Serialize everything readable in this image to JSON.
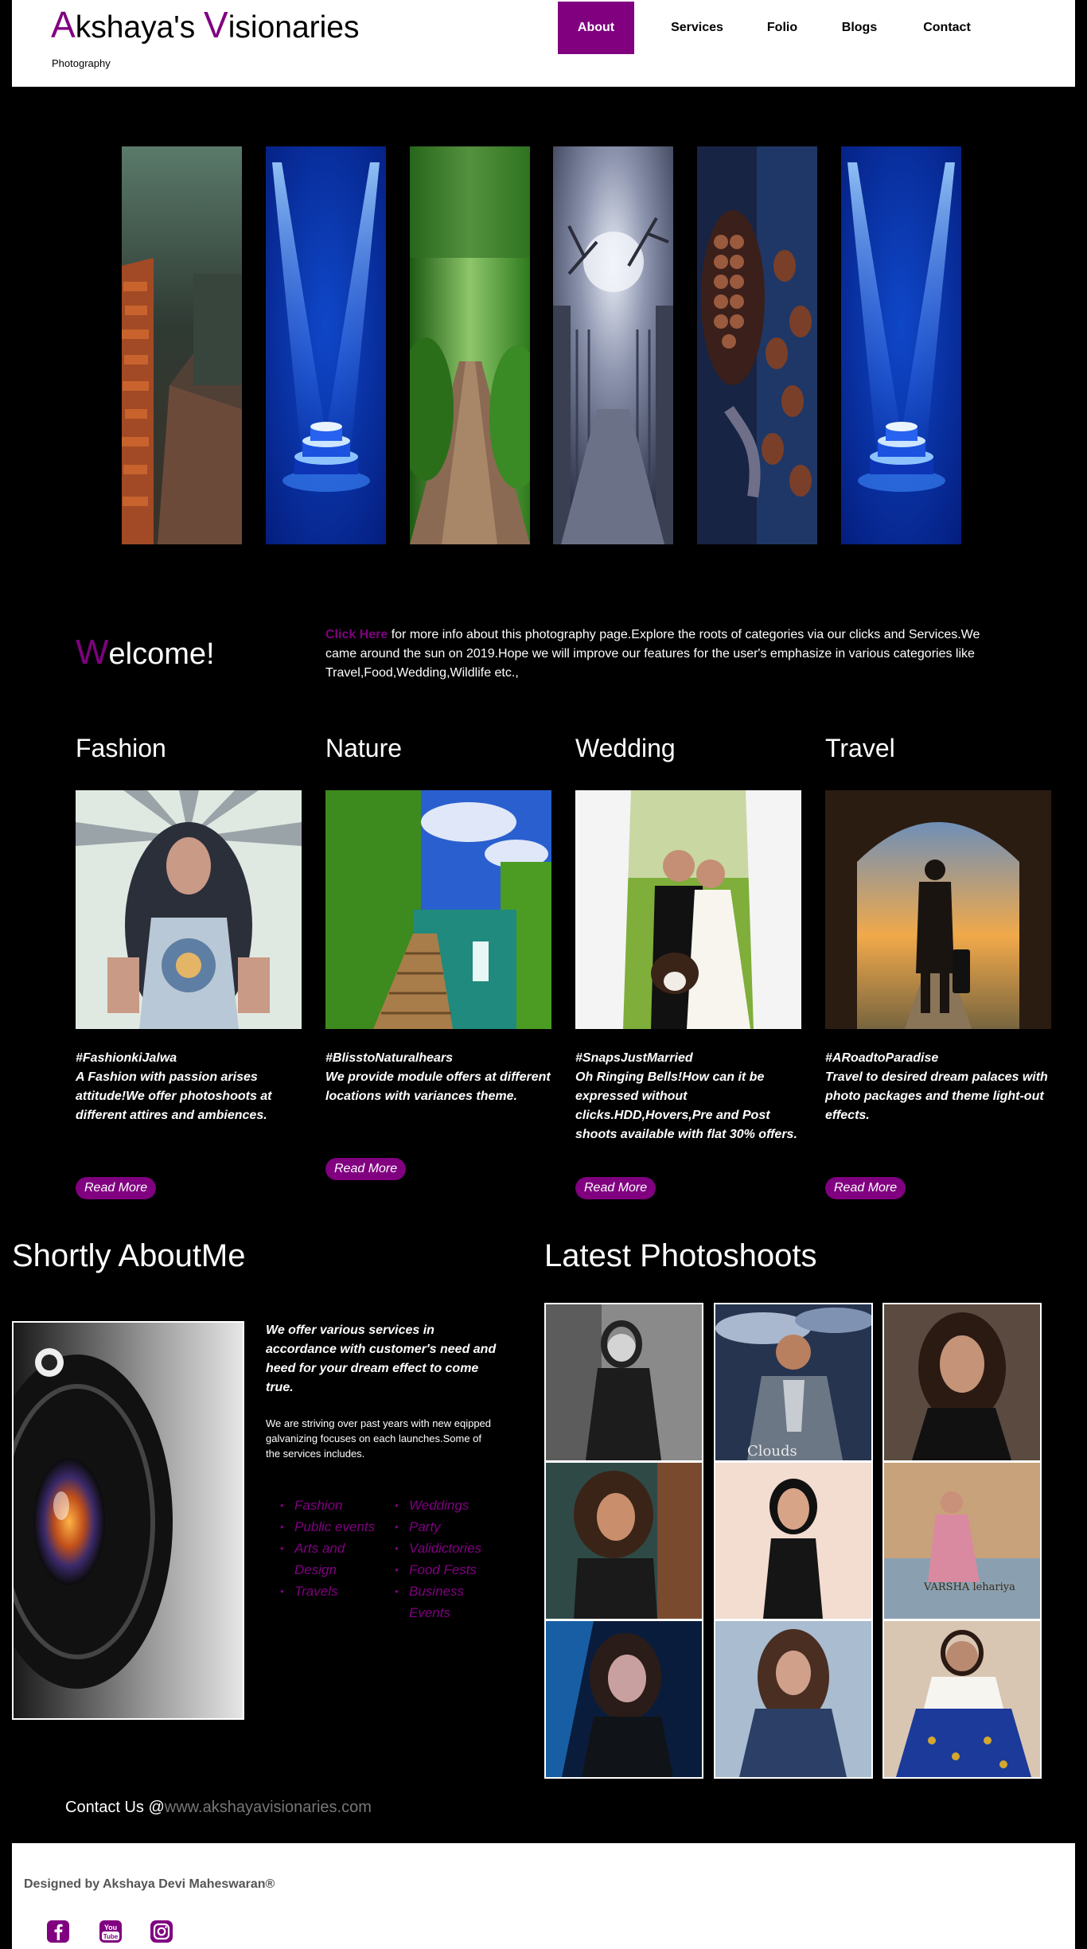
{
  "brand": {
    "first_initial": "A",
    "first_rest": "kshaya's ",
    "second_initial": "V",
    "second_rest": "isionaries",
    "tagline": "Photography",
    "accent_color": "#800080"
  },
  "nav": {
    "items": [
      {
        "label": "About",
        "active": true
      },
      {
        "label": "Services",
        "active": false
      },
      {
        "label": "Folio",
        "active": false
      },
      {
        "label": "Blogs",
        "active": false
      },
      {
        "label": "Contact",
        "active": false
      }
    ]
  },
  "hero": {
    "strips": [
      "brick-wall-path-image",
      "blue-spotlight-stage-image",
      "forest-trail-image",
      "moonlit-gate-image",
      "chocolate-truffles-image",
      "blue-spotlight-stage-image"
    ]
  },
  "welcome": {
    "initial": "W",
    "rest": "elcome!",
    "link_text": "Click Here",
    "text": " for more info about this photography page.Explore the roots of categories via our clicks and Services.We came around the sun on 2019.Hope we will improve our features for the user's emphasize in various categories like Travel,Food,Wedding,Wildlife etc.,"
  },
  "categories": [
    {
      "title": "Fashion",
      "tag": "#FashionkiJalwa",
      "text": "A Fashion with passion arises attitude!We offer photoshoots at different attires and ambiences.",
      "button": "Read More"
    },
    {
      "title": "Nature",
      "tag": "#BlisstoNaturalhears",
      "text": "We provide module offers at different locations with variances theme.",
      "button": "Read More"
    },
    {
      "title": "Wedding",
      "tag": "#SnapsJustMarried",
      "text": "Oh Ringing Bells!How can it be expressed without clicks.HDD,Hovers,Pre and Post shoots available with flat 30% offers.",
      "button": "Read More"
    },
    {
      "title": "Travel",
      "tag": "#ARoadtoParadise",
      "text": "Travel to desired dream palaces with photo packages and theme light-out effects.",
      "button": "Read More"
    }
  ],
  "about": {
    "title": "Shortly AboutMe",
    "lead": "We offer various services in accordance with customer's need and heed for your dream effect to come true.",
    "text": "We are striving over past years with new eqipped galvanizing focuses on each launches.Some of the services includes.",
    "services_left": [
      "Fashion",
      "Public events",
      "Arts and Design",
      "Travels"
    ],
    "services_right": [
      "Weddings",
      "Party",
      "Validictories",
      "Food Fests",
      "Business Events"
    ]
  },
  "gallery": {
    "title": "Latest Photoshoots",
    "photos": [
      {
        "caption": ""
      },
      {
        "caption": "Clouds"
      },
      {
        "caption": ""
      },
      {
        "caption": ""
      },
      {
        "caption": ""
      },
      {
        "caption": "VARSHA lehariya"
      },
      {
        "caption": ""
      },
      {
        "caption": ""
      },
      {
        "caption": ""
      }
    ]
  },
  "contact": {
    "label": "Contact Us @",
    "email": "www.akshayavisionaries.com"
  },
  "footer": {
    "credit": "Designed by Akshaya Devi Maheswaran®",
    "social": [
      "facebook-icon",
      "youtube-icon",
      "instagram-icon"
    ],
    "youtube_text_1": "You",
    "youtube_text_2": "Tube"
  }
}
